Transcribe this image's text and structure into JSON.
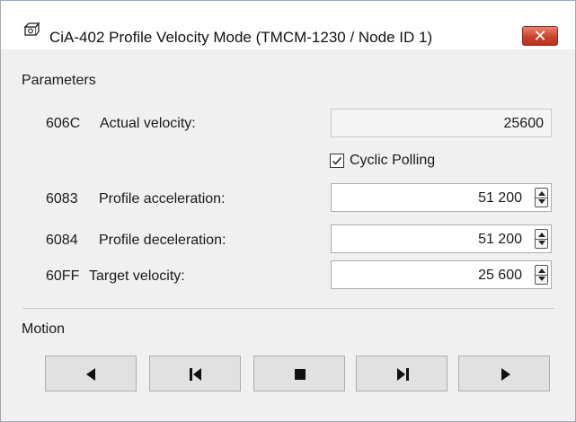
{
  "window": {
    "title": "CiA-402 Profile Velocity Mode (TMCM-1230 / Node ID 1)",
    "title_icon": "gear-app-icon",
    "close_glyph": "✕"
  },
  "parameters": {
    "group_label": "Parameters",
    "actual_velocity": {
      "code": "606C",
      "label": "Actual velocity:",
      "value": "25600"
    },
    "cyclic_polling": {
      "label": "Cyclic Polling",
      "checked": true
    },
    "profile_acceleration": {
      "code": "6083",
      "label": "Profile acceleration:",
      "value": "51 200"
    },
    "profile_deceleration": {
      "code": "6084",
      "label": "Profile deceleration:",
      "value": "51 200"
    },
    "target_velocity": {
      "code": "60FF",
      "label": "Target velocity:",
      "value": "25 600"
    }
  },
  "motion": {
    "group_label": "Motion",
    "buttons": [
      {
        "name": "rotate-left",
        "icon": "play-left-icon"
      },
      {
        "name": "step-left",
        "icon": "skip-left-icon"
      },
      {
        "name": "stop",
        "icon": "stop-icon"
      },
      {
        "name": "step-right",
        "icon": "skip-right-icon"
      },
      {
        "name": "rotate-right",
        "icon": "play-right-icon"
      }
    ]
  },
  "colors": {
    "close_button": "#c7402b",
    "window_bg": "#f0f0f0",
    "button_bg": "#e1e1e1"
  }
}
